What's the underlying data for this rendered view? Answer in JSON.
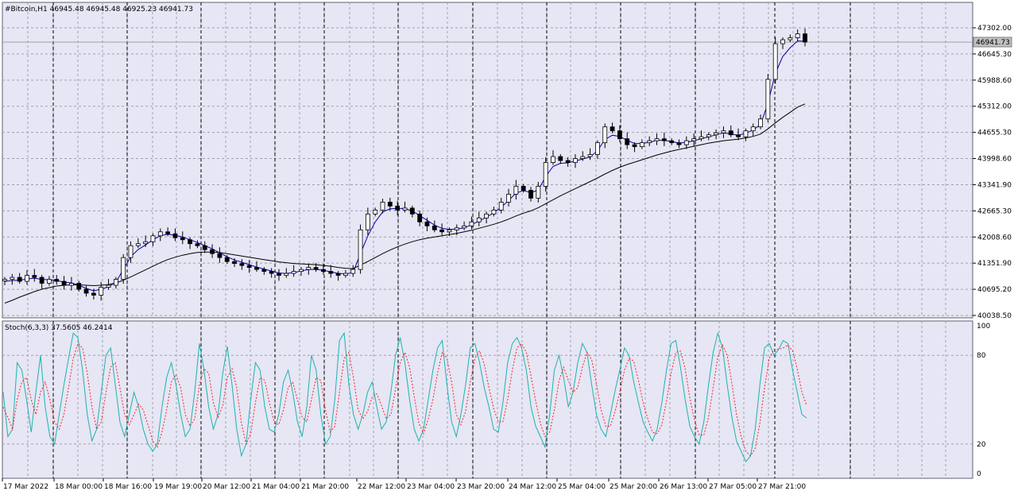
{
  "window": {
    "symbol_info": "#Bitcoin,H1  46945.48 46945.48 46925.23 46941.73",
    "price_tag": "46941.73"
  },
  "colors": {
    "background": "#e6e6f5",
    "grid": "#a0a0b0",
    "vline": "#000000",
    "candle": "#000000",
    "ma_fast": "#0000b0",
    "ma_slow": "#000000",
    "stoch_main": "#20b2aa",
    "stoch_signal": "#ff2020",
    "bid_line": "#a0a0a0"
  },
  "chart_data": [
    {
      "type": "candlestick",
      "symbol": "#Bitcoin",
      "timeframe": "H1",
      "ohlc_header": {
        "open": 46945.48,
        "high": 46945.48,
        "low": 46925.23,
        "close": 46941.73
      },
      "current_price": 46941.73,
      "ylim": [
        40038.5,
        47500
      ],
      "y_ticks": [
        "47302.00",
        "46645.30",
        "45988.60",
        "45312.00",
        "44655.30",
        "43998.60",
        "43341.90",
        "42665.30",
        "42008.60",
        "41351.90",
        "40695.20",
        "40038.50"
      ],
      "x_ticks": [
        "17 Mar 2022",
        "18 Mar 00:00",
        "18 Mar 16:00",
        "19 Mar 19:00",
        "20 Mar 12:00",
        "21 Mar 04:00",
        "21 Mar 20:00",
        "22 Mar 12:00",
        "23 Mar 04:00",
        "23 Mar 20:00",
        "24 Mar 12:00",
        "25 Mar 04:00",
        "25 Mar 20:00",
        "26 Mar 13:00",
        "27 Mar 05:00",
        "27 Mar 21:00"
      ],
      "closes": [
        40950,
        41000,
        40900,
        41050,
        41000,
        40850,
        40950,
        40900,
        40800,
        40850,
        40700,
        40600,
        40550,
        40750,
        40800,
        40950,
        41500,
        41800,
        41850,
        41900,
        42050,
        42150,
        42100,
        42000,
        41950,
        41850,
        41800,
        41700,
        41600,
        41500,
        41400,
        41350,
        41300,
        41250,
        41200,
        41150,
        41100,
        41050,
        41100,
        41150,
        41200,
        41250,
        41200,
        41150,
        41100,
        41050,
        41100,
        41200,
        42200,
        42600,
        42700,
        42900,
        42800,
        42700,
        42750,
        42600,
        42400,
        42300,
        42200,
        42150,
        42200,
        42250,
        42300,
        42400,
        42500,
        42600,
        42700,
        42900,
        43100,
        43300,
        43200,
        43000,
        43300,
        43900,
        44050,
        43950,
        43900,
        44000,
        44050,
        44100,
        44400,
        44800,
        44700,
        44500,
        44350,
        44300,
        44400,
        44450,
        44500,
        44450,
        44400,
        44350,
        44450,
        44500,
        44550,
        44600,
        44650,
        44700,
        44600,
        44550,
        44700,
        44800,
        45000,
        46000,
        46900,
        47000,
        47050,
        47150,
        46941.73
      ],
      "series": [
        {
          "name": "",
          "role": "moving-average-fast",
          "values": [
            40900,
            40920,
            40930,
            40960,
            40980,
            40950,
            40940,
            40920,
            40880,
            40860,
            40800,
            40720,
            40660,
            40700,
            40760,
            40880,
            41200,
            41520,
            41700,
            41820,
            41950,
            42050,
            42090,
            42060,
            42020,
            41950,
            41880,
            41800,
            41720,
            41620,
            41520,
            41440,
            41380,
            41320,
            41260,
            41210,
            41160,
            41110,
            41100,
            41120,
            41160,
            41200,
            41200,
            41180,
            41140,
            41100,
            41090,
            41120,
            41600,
            42050,
            42400,
            42650,
            42730,
            42740,
            42740,
            42680,
            42560,
            42440,
            42320,
            42240,
            42210,
            42220,
            42250,
            42330,
            42420,
            42520,
            42630,
            42770,
            42940,
            43130,
            43190,
            43140,
            43200,
            43550,
            43800,
            43880,
            43890,
            43940,
            43990,
            44040,
            44200,
            44480,
            44590,
            44560,
            44460,
            44380,
            44380,
            44410,
            44460,
            44460,
            44430,
            44390,
            44410,
            44450,
            44500,
            44550,
            44600,
            44650,
            44620,
            44590,
            44640,
            44720,
            44860,
            45400,
            46150,
            46580,
            46800,
            46970,
            46960
          ]
        },
        {
          "name": "",
          "role": "moving-average-slow",
          "values": [
            40350,
            40420,
            40500,
            40570,
            40640,
            40700,
            40740,
            40780,
            40800,
            40810,
            40810,
            40800,
            40790,
            40800,
            40820,
            40860,
            40930,
            41010,
            41100,
            41190,
            41280,
            41370,
            41450,
            41510,
            41560,
            41600,
            41630,
            41640,
            41640,
            41630,
            41600,
            41570,
            41540,
            41510,
            41480,
            41450,
            41420,
            41390,
            41370,
            41350,
            41340,
            41330,
            41320,
            41300,
            41280,
            41250,
            41230,
            41220,
            41310,
            41400,
            41500,
            41600,
            41690,
            41770,
            41840,
            41900,
            41950,
            41990,
            42020,
            42050,
            42080,
            42110,
            42150,
            42190,
            42240,
            42290,
            42340,
            42400,
            42470,
            42550,
            42620,
            42680,
            42760,
            42860,
            42960,
            43060,
            43150,
            43240,
            43330,
            43420,
            43510,
            43610,
            43700,
            43780,
            43850,
            43910,
            43970,
            44030,
            44090,
            44140,
            44190,
            44230,
            44270,
            44310,
            44350,
            44390,
            44420,
            44450,
            44470,
            44490,
            44520,
            44560,
            44620,
            44750,
            44900,
            45040,
            45170,
            45300,
            45380
          ]
        }
      ]
    },
    {
      "type": "line",
      "indicator": "Stoch(6,3,3)",
      "label": "Stoch(6,3,3) 37.5605 46.2414",
      "main_value": 37.5605,
      "signal_value": 46.2414,
      "ylim": [
        0,
        100
      ],
      "y_ticks": [
        "100",
        "80",
        "20",
        "0"
      ],
      "series": [
        {
          "name": "",
          "role": "main",
          "values": [
            55,
            25,
            30,
            75,
            70,
            50,
            28,
            55,
            80,
            45,
            25,
            20,
            40,
            60,
            78,
            95,
            92,
            70,
            40,
            22,
            30,
            55,
            80,
            85,
            60,
            35,
            25,
            40,
            55,
            45,
            30,
            20,
            15,
            20,
            45,
            65,
            75,
            60,
            40,
            25,
            30,
            55,
            88,
            70,
            45,
            30,
            40,
            68,
            86,
            60,
            30,
            12,
            20,
            50,
            75,
            70,
            45,
            30,
            28,
            40,
            62,
            70,
            55,
            35,
            25,
            45,
            80,
            70,
            40,
            20,
            25,
            50,
            90,
            95,
            60,
            40,
            30,
            40,
            55,
            62,
            45,
            30,
            35,
            55,
            80,
            92,
            75,
            50,
            30,
            22,
            30,
            50,
            70,
            85,
            90,
            60,
            35,
            25,
            40,
            60,
            85,
            88,
            75,
            58,
            45,
            30,
            28,
            48,
            75,
            88,
            92,
            85,
            70,
            45,
            32,
            25,
            18,
            40,
            70,
            80,
            65,
            45,
            55,
            75,
            88,
            82,
            60,
            40,
            30,
            25,
            40,
            56,
            70,
            85,
            80,
            62,
            48,
            35,
            28,
            22,
            30,
            48,
            70,
            88,
            90,
            72,
            50,
            32,
            25,
            20,
            35,
            60,
            82,
            95,
            85,
            60,
            38,
            22,
            15,
            8,
            12,
            30,
            60,
            85,
            88,
            80,
            84,
            90,
            88,
            70,
            55,
            40,
            37.56
          ]
        },
        {
          "name": "",
          "role": "signal",
          "values": [
            45,
            38,
            30,
            50,
            62,
            65,
            50,
            40,
            55,
            62,
            50,
            35,
            30,
            40,
            58,
            78,
            88,
            85,
            68,
            45,
            30,
            35,
            55,
            72,
            75,
            58,
            40,
            33,
            40,
            47,
            43,
            33,
            22,
            18,
            28,
            43,
            62,
            67,
            58,
            40,
            32,
            37,
            60,
            71,
            68,
            48,
            38,
            46,
            65,
            71,
            58,
            34,
            20,
            27,
            48,
            65,
            63,
            48,
            35,
            33,
            43,
            58,
            62,
            50,
            38,
            35,
            50,
            65,
            63,
            43,
            28,
            32,
            55,
            78,
            82,
            65,
            43,
            37,
            42,
            52,
            54,
            46,
            37,
            40,
            57,
            75,
            82,
            72,
            52,
            34,
            27,
            37,
            50,
            68,
            82,
            78,
            62,
            40,
            33,
            42,
            62,
            78,
            83,
            74,
            58,
            44,
            35,
            35,
            50,
            70,
            85,
            88,
            82,
            66,
            49,
            34,
            25,
            28,
            43,
            63,
            72,
            63,
            55,
            58,
            72,
            82,
            77,
            61,
            43,
            32,
            32,
            42,
            55,
            70,
            78,
            76,
            63,
            48,
            37,
            28,
            27,
            33,
            49,
            68,
            82,
            83,
            71,
            51,
            36,
            26,
            26,
            38,
            58,
            79,
            87,
            80,
            61,
            40,
            25,
            15,
            12,
            17,
            34,
            58,
            78,
            84,
            84,
            85,
            87,
            83,
            71,
            55,
            46.24
          ]
        }
      ]
    }
  ]
}
